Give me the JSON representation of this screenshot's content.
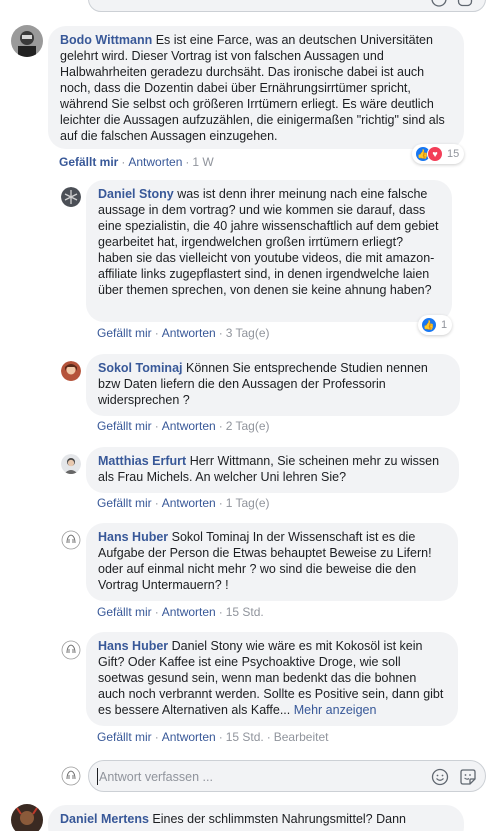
{
  "comments": [
    {
      "author": "Bodo Wittmann",
      "text": "Es ist eine Farce, was an deutschen Universitäten gelehrt wird. Dieser Vortrag ist von falschen Aussagen und Halbwahrheiten geradezu durchsäht. Das ironische dabei ist auch noch, dass die Dozentin dabei über Ernährungsirrtümer spricht, während Sie selbst och größeren Irrtümern erliegt. Es wäre deutlich leichter die Aussagen aufzuzählen, die einigermaßen \"richtig\" sind als auf die falschen Aussagen einzugehen.",
      "like": "Gefällt mir",
      "reply": "Antworten",
      "time": "1 W",
      "reactions": "15"
    }
  ],
  "replies": [
    {
      "author": "Daniel Stony",
      "text": "was ist denn ihrer meinung nach eine falsche aussage in dem vortrag? und wie kommen sie darauf, dass eine spezialistin, die 40 jahre wissenschaftlich auf dem gebiet gearbeitet hat, irgendwelchen großen irrtümern erliegt? haben sie das vielleicht von youtube videos, die mit amazon-affiliate links zugepflastert sind, in denen irgendwelche laien über themen sprechen, von denen sie keine ahnung haben?",
      "like": "Gefällt mir",
      "reply": "Antworten",
      "time": "3 Tag(e)",
      "reactions": "1"
    },
    {
      "author": "Sokol Tominaj",
      "text": "Können Sie entsprechende Studien nennen bzw Daten liefern die den Aussagen der Professorin widersprechen ?",
      "like": "Gefällt mir",
      "reply": "Antworten",
      "time": "2 Tag(e)"
    },
    {
      "author": "Matthias Erfurt",
      "text": "Herr Wittmann, Sie scheinen mehr zu wissen als Frau Michels. An welcher Uni lehren Sie?",
      "like": "Gefällt mir",
      "reply": "Antworten",
      "time": "1 Tag(e)"
    },
    {
      "author": "Hans Huber",
      "text": "Sokol Tominaj In der Wissenschaft ist es die Aufgabe der Person die Etwas behauptet Beweise zu Lifern! oder auf einmal nicht mehr ? wo sind die beweise die den Vortrag Untermauern? !",
      "like": "Gefällt mir",
      "reply": "Antworten",
      "time": "15 Std."
    },
    {
      "author": "Hans Huber",
      "text": "Daniel Stony wie wäre es mit Kokosöl ist kein Gift? Oder Kaffee ist eine Psychoaktive Droge, wie soll soetwas gesund sein, wenn man bedenkt das die bohnen auch noch verbrannt werden. Sollte es Positive sein, dann gibt es bessere Alternativen als Kaffe...",
      "more": "Mehr anzeigen",
      "like": "Gefällt mir",
      "reply": "Antworten",
      "time": "15 Std.",
      "edited": "Bearbeitet"
    }
  ],
  "reply_box": {
    "placeholder": "Antwort verfassen ..."
  },
  "next_comment": {
    "author": "Daniel Mertens",
    "text": "Eines der schlimmsten Nahrungsmittel? Dann"
  },
  "colors": {
    "link": "#385898",
    "bubble": "#f2f3f5",
    "meta": "#90949c",
    "like": "#1877f2",
    "love": "#f33e58"
  }
}
